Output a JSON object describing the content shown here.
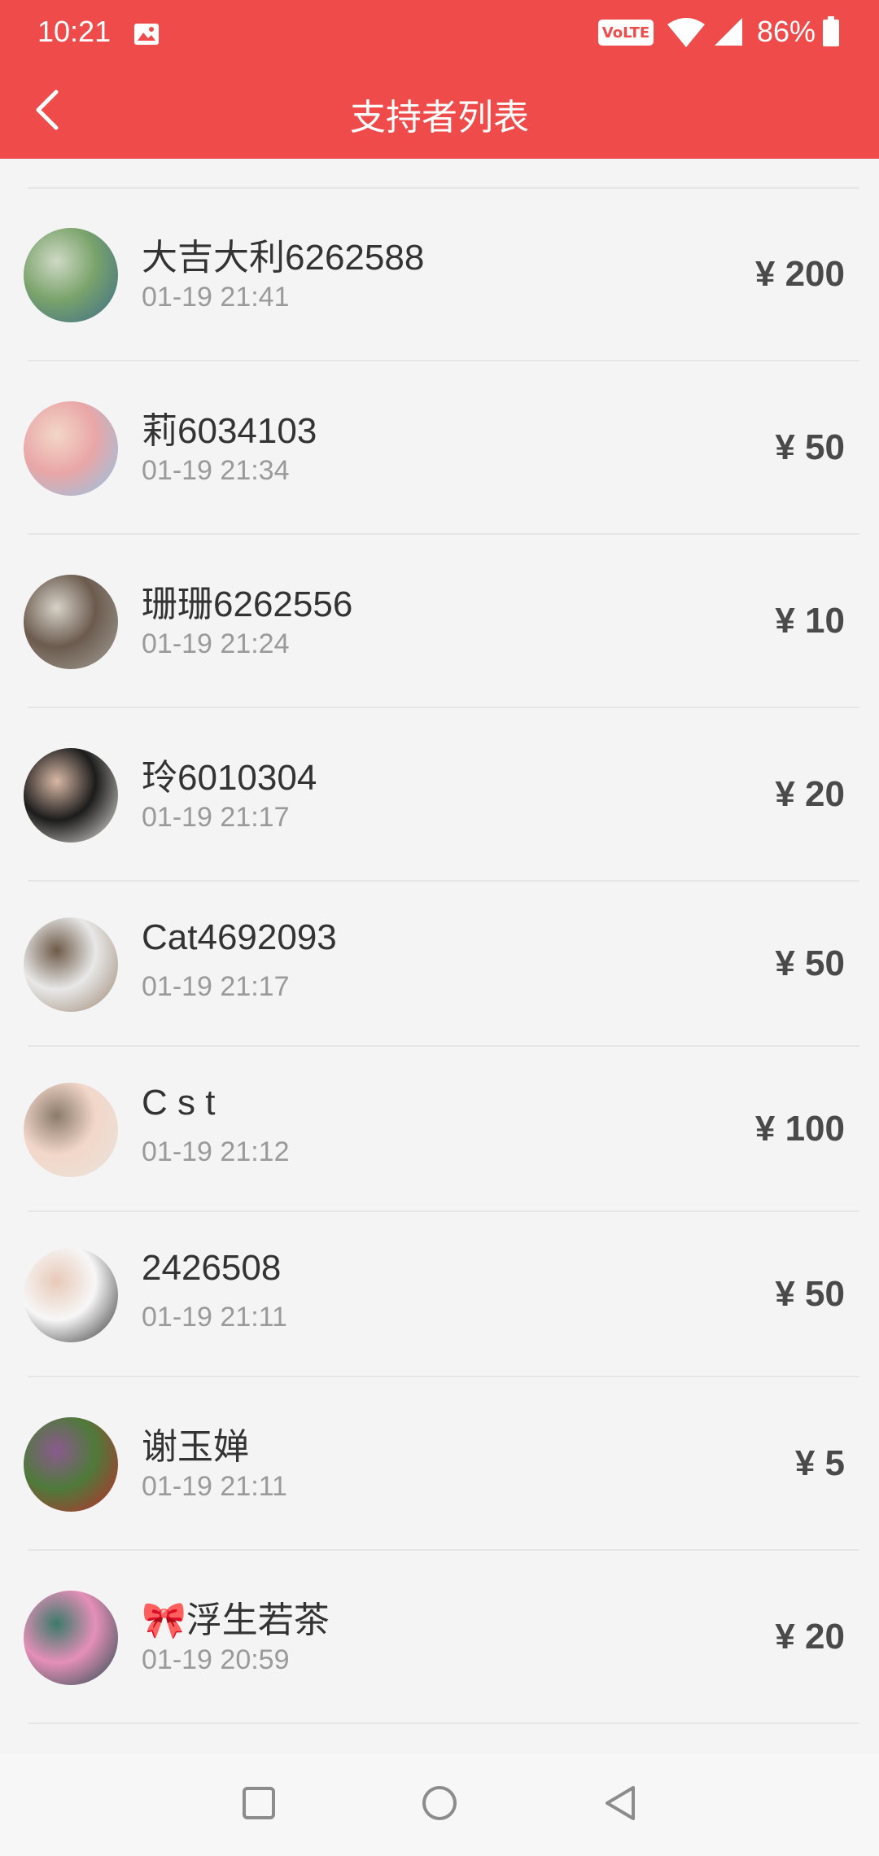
{
  "status_bar": {
    "time": "10:21",
    "volte": "VoLTE",
    "battery": "86%",
    "icons": [
      "image-icon",
      "volte-icon",
      "wifi-icon",
      "signal-icon",
      "battery-icon"
    ]
  },
  "header": {
    "title": "支持者列表",
    "back_icon": "chevron-left-icon",
    "background": "#ef4b4b"
  },
  "supporters": [
    {
      "name": "大吉大利6262588",
      "time": "01-19 21:41",
      "amount": "¥ 200",
      "avatar_colors": [
        "#3a6b8a",
        "#7aa36b",
        "#cfd9c5"
      ]
    },
    {
      "name": "莉6034103",
      "time": "01-19 21:34",
      "amount": "¥ 50",
      "avatar_colors": [
        "#8ec5e8",
        "#e9a6a6",
        "#f3d6c8"
      ]
    },
    {
      "name": "珊珊6262556",
      "time": "01-19 21:24",
      "amount": "¥ 10",
      "avatar_colors": [
        "#a7a39a",
        "#6b5b4e",
        "#d7d2c8"
      ]
    },
    {
      "name": "玲6010304",
      "time": "01-19 21:17",
      "amount": "¥ 20",
      "avatar_colors": [
        "#f0ede8",
        "#1c1c1c",
        "#d9b8a5"
      ]
    },
    {
      "name": "Cat4692093",
      "time": "01-19 21:17",
      "amount": "¥ 50",
      "avatar_colors": [
        "#9a8470",
        "#e8e8e8",
        "#6e5a48"
      ]
    },
    {
      "name": "C s t",
      "time": "01-19 21:12",
      "amount": "¥ 100",
      "avatar_colors": [
        "#e9e3dc",
        "#f2d7c9",
        "#8b7b6b"
      ]
    },
    {
      "name": "2426508",
      "time": "01-19 21:11",
      "amount": "¥ 50",
      "avatar_colors": [
        "#2a2a2a",
        "#f7f7f7",
        "#e8c9b8"
      ]
    },
    {
      "name": "谢玉婵",
      "time": "01-19 21:11",
      "amount": "¥ 5",
      "avatar_colors": [
        "#c0282f",
        "#4f7a3a",
        "#8a5a8e"
      ]
    },
    {
      "name": "🎀浮生若茶",
      "time": "01-19 20:59",
      "amount": "¥ 20",
      "avatar_colors": [
        "#1f4a4a",
        "#e58fb8",
        "#3c7a6a"
      ]
    }
  ],
  "navbar": {
    "recents": "square-icon",
    "home": "circle-icon",
    "back": "triangle-back-icon"
  }
}
